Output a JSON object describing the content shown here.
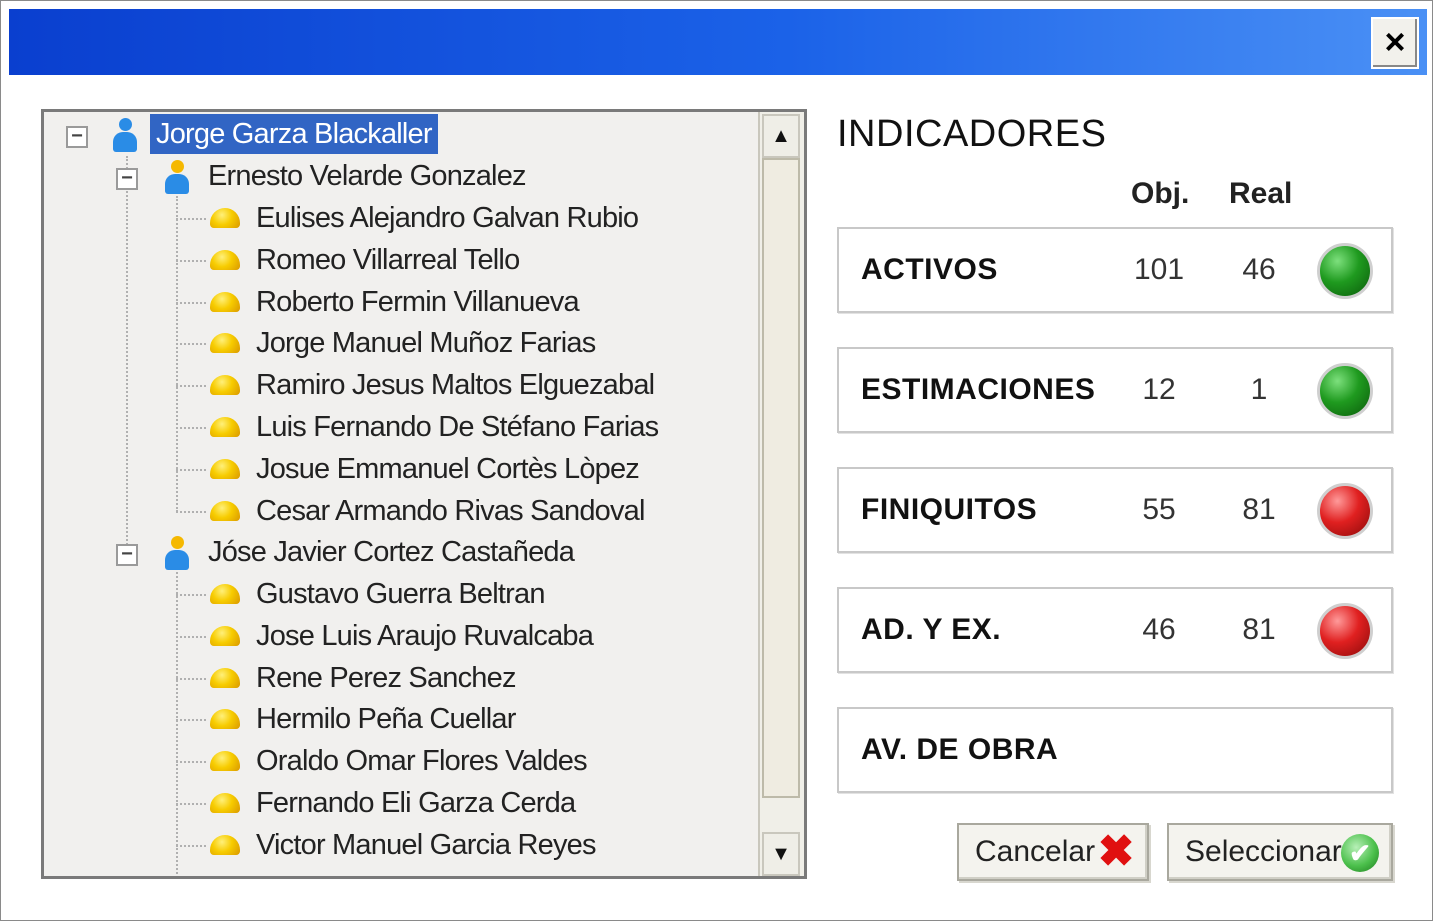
{
  "window": {
    "close_label": "×"
  },
  "tree": {
    "root": "Jorge Garza Blackaller",
    "groups": [
      {
        "name": "Ernesto Velarde Gonzalez",
        "members": [
          "Eulises Alejandro Galvan Rubio",
          "Romeo Villarreal Tello",
          "Roberto Fermin Villanueva",
          "Jorge Manuel Muñoz Farias",
          "Ramiro Jesus Maltos Elguezabal",
          "Luis Fernando De Stéfano Farias",
          "Josue Emmanuel Cortès Lòpez",
          "Cesar Armando Rivas Sandoval"
        ]
      },
      {
        "name": "Jóse Javier Cortez Castañeda",
        "members": [
          "Gustavo Guerra Beltran",
          "Jose Luis Araujo Ruvalcaba",
          "Rene Perez Sanchez",
          "Hermilo Peña Cuellar",
          "Oraldo Omar Flores Valdes",
          "Fernando Eli Garza Cerda",
          "Victor Manuel Garcia Reyes"
        ]
      }
    ],
    "expander_symbol": "−",
    "scroll_up": "▲",
    "scroll_down": "▼"
  },
  "indicators": {
    "title": "INDICADORES",
    "col_obj": "Obj.",
    "col_real": "Real",
    "rows": [
      {
        "name": "ACTIVOS",
        "obj": "101",
        "real": "46",
        "status": "green"
      },
      {
        "name": "ESTIMACIONES",
        "obj": "12",
        "real": "1",
        "status": "green"
      },
      {
        "name": "FINIQUITOS",
        "obj": "55",
        "real": "81",
        "status": "red"
      },
      {
        "name": "AD. Y EX.",
        "obj": "46",
        "real": "81",
        "status": "red"
      },
      {
        "name": "AV. DE OBRA",
        "obj": "",
        "real": "",
        "status": ""
      }
    ]
  },
  "buttons": {
    "cancel_label": "Cancelar",
    "select_label": "Seleccionar",
    "cancel_icon": "✖",
    "select_icon": "✔"
  },
  "colors": {
    "titlebar_start": "#0a3fcf",
    "titlebar_end": "#4a90f5",
    "selection": "#3165c4",
    "status_green": "#1f9a1f",
    "status_red": "#e02020"
  }
}
